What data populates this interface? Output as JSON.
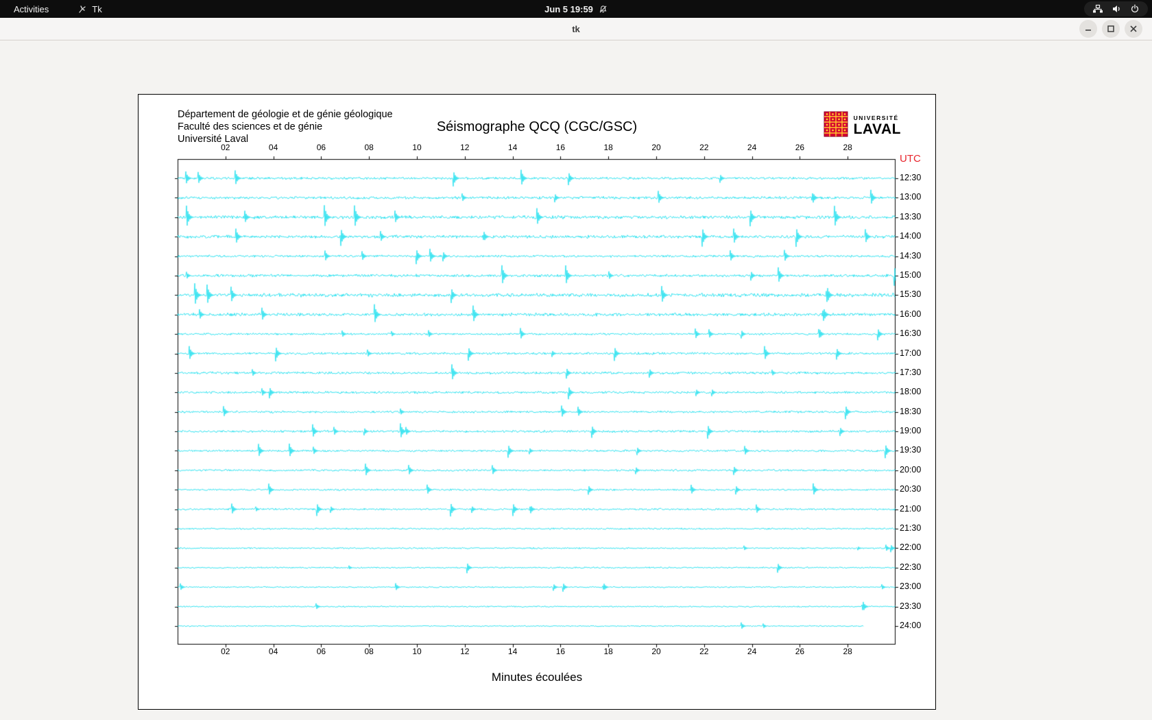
{
  "topbar": {
    "activities_label": "Activities",
    "app_label": "Tk",
    "clock": "Jun 5 19:59"
  },
  "titlebar": {
    "title": "tk"
  },
  "window": {
    "institution_lines": [
      "Département de géologie et de génie géologique",
      "Faculté des sciences et de génie",
      "Université Laval"
    ],
    "title": "Séismographe QCQ (CGC/GSC)",
    "logo": {
      "line1": "UNIVERSITÉ",
      "line2": "LAVAL",
      "shield_color": "#d50032",
      "shield_gold": "#ffc72c"
    },
    "utc_label": "UTC",
    "utc_color": "#e8252d",
    "xlabel": "Minutes écoulées",
    "trace_color": "#00dcec"
  },
  "chart_data": {
    "type": "line",
    "title": "Séismographe QCQ (CGC/GSC)",
    "xlabel": "Minutes écoulées",
    "right_axis_label": "UTC",
    "x_range_minutes": [
      0,
      30
    ],
    "x_tick_minutes": [
      2,
      4,
      6,
      8,
      10,
      12,
      14,
      16,
      18,
      20,
      22,
      24,
      26,
      28
    ],
    "x_ticks": [
      "02",
      "04",
      "06",
      "08",
      "10",
      "12",
      "14",
      "16",
      "18",
      "20",
      "22",
      "24",
      "26",
      "28"
    ],
    "rows": [
      {
        "time": "12:30",
        "amp": 1.4,
        "sp": 0.005
      },
      {
        "time": "13:00",
        "amp": 1.6,
        "sp": 0.006,
        "events": [
          {
            "pos": 0.885,
            "mag": 8
          }
        ]
      },
      {
        "time": "13:30",
        "amp": 2.0,
        "sp": 0.007
      },
      {
        "time": "14:00",
        "amp": 1.8,
        "sp": 0.006,
        "events": [
          {
            "pos": 0.427,
            "mag": 7
          }
        ]
      },
      {
        "time": "14:30",
        "amp": 1.4,
        "sp": 0.005
      },
      {
        "time": "15:00",
        "amp": 1.7,
        "sp": 0.006
      },
      {
        "time": "15:30",
        "amp": 2.2,
        "sp": 0.007,
        "events": [
          {
            "pos": 0.905,
            "mag": 12
          }
        ]
      },
      {
        "time": "16:00",
        "amp": 1.9,
        "sp": 0.006,
        "events": [
          {
            "pos": 0.9,
            "mag": 10
          }
        ]
      },
      {
        "time": "16:30",
        "amp": 1.2,
        "sp": 0.005,
        "events": [
          {
            "pos": 0.895,
            "mag": 6
          }
        ]
      },
      {
        "time": "17:00",
        "amp": 1.4,
        "sp": 0.006
      },
      {
        "time": "17:30",
        "amp": 1.5,
        "sp": 0.007
      },
      {
        "time": "18:00",
        "amp": 1.4,
        "sp": 0.006
      },
      {
        "time": "18:30",
        "amp": 1.3,
        "sp": 0.005
      },
      {
        "time": "19:00",
        "amp": 1.4,
        "sp": 0.006
      },
      {
        "time": "19:30",
        "amp": 1.2,
        "sp": 0.005
      },
      {
        "time": "20:00",
        "amp": 1.2,
        "sp": 0.005
      },
      {
        "time": "20:30",
        "amp": 1.1,
        "sp": 0.004
      },
      {
        "time": "21:00",
        "amp": 1.2,
        "sp": 0.005,
        "events": [
          {
            "pos": 0.492,
            "mag": 6
          }
        ]
      },
      {
        "time": "21:30",
        "amp": 1.0,
        "sp": 0.003
      },
      {
        "time": "22:00",
        "amp": 0.9,
        "sp": 0.003
      },
      {
        "time": "22:30",
        "amp": 0.9,
        "sp": 0.002
      },
      {
        "time": "23:00",
        "amp": 0.8,
        "sp": 0.002,
        "events": [
          {
            "pos": 0.594,
            "mag": 5
          }
        ]
      },
      {
        "time": "23:30",
        "amp": 0.8,
        "sp": 0.002,
        "events": [
          {
            "pos": 0.955,
            "mag": 7
          }
        ]
      },
      {
        "time": "24:00",
        "amp": 0.7,
        "sp": 0.001,
        "len": 0.955
      }
    ]
  }
}
